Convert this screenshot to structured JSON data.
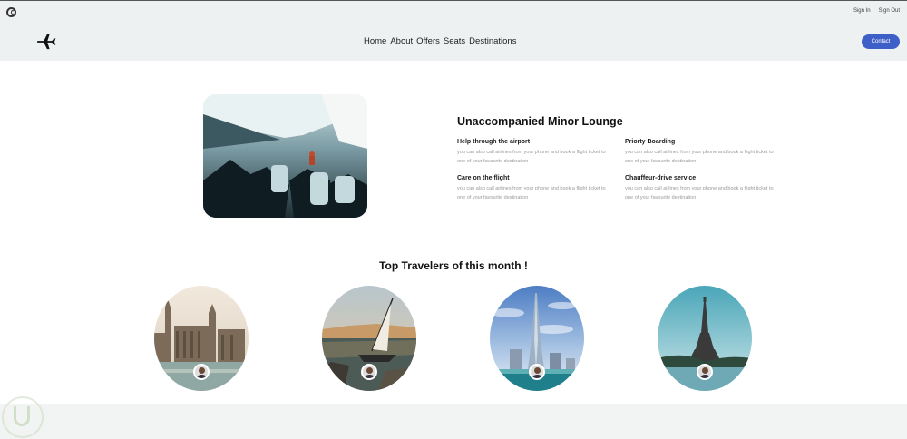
{
  "header": {
    "auth": {
      "sign_in": "Sign In",
      "sign_out": "Sign Out"
    },
    "nav": [
      "Home",
      "About",
      "Offers",
      "Seats",
      "Destinations"
    ],
    "contact_label": "Contact",
    "logo_icon": "c-logo-icon",
    "brand_icon": "airplane-icon"
  },
  "lounge": {
    "title": "Unaccompanied Minor Lounge",
    "features": [
      {
        "title": "Help through the airport",
        "desc": "you can also call airlines from your phone and book a flight ticket to one of your favourite destination"
      },
      {
        "title": "Priorty Boarding",
        "desc": "you can also call airlines from your phone and book a flight ticket to one of your favourite destination"
      },
      {
        "title": "Care on the flight",
        "desc": "you can also call airlines from your phone and book a flight ticket to one of your favourite destination"
      },
      {
        "title": "Chauffeur-drive service",
        "desc": "you can also call airlines from your phone and book a flight ticket to one of your favourite destination"
      }
    ]
  },
  "travelers": {
    "title": "Top Travelers of this month !"
  },
  "colors": {
    "accent": "#3f5fc8",
    "header_bg": "#eef1f2",
    "page_bg": "#f2f3f3"
  }
}
